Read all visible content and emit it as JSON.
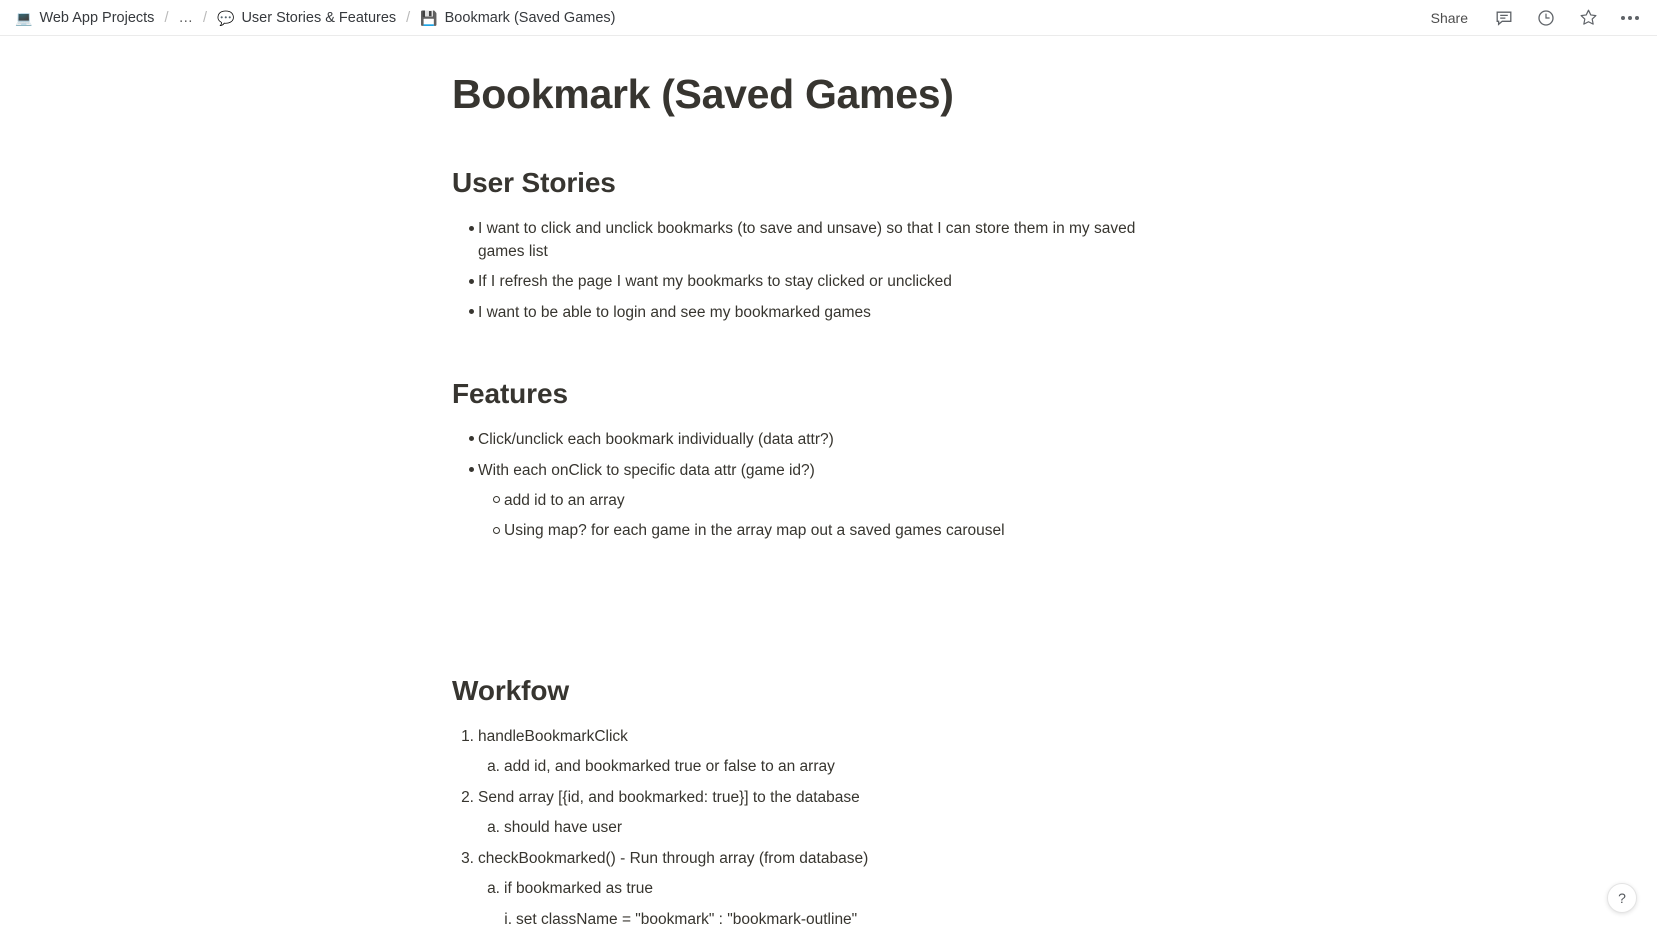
{
  "topbar": {
    "breadcrumb": [
      {
        "icon": "💻",
        "icon_name": "laptop-emoji",
        "label": "Web App Projects"
      },
      {
        "icon": "",
        "icon_name": "",
        "label": "…"
      },
      {
        "icon": "💬",
        "icon_name": "speech-balloon-emoji",
        "label": "User Stories & Features"
      },
      {
        "icon": "💾",
        "icon_name": "floppy-disk-emoji",
        "label": "Bookmark (Saved Games)"
      }
    ],
    "separator": "/",
    "share_label": "Share",
    "icons": [
      "comment-icon",
      "history-clock-icon",
      "star-icon",
      "more-options-icon"
    ]
  },
  "document": {
    "title": "Bookmark (Saved Games)",
    "sections": [
      {
        "heading": "User Stories",
        "items": [
          "I want to click and unclick bookmarks (to save and unsave) so that I can store them in my saved games list",
          "If I refresh the page I want my bookmarks to stay clicked or unclicked",
          "I want to be able to login and see my bookmarked games"
        ]
      },
      {
        "heading": "Features",
        "items": [
          "Click/unclick each bookmark individually (data attr?)",
          "With each onClick to specific data attr (game id?)"
        ],
        "subitems": [
          "add id to an array",
          "Using map? for each game in the array map out a saved games carousel"
        ]
      },
      {
        "heading": "Workfow",
        "steps": [
          {
            "marker": "1.",
            "text": "handleBookmarkClick"
          },
          {
            "marker": "a.",
            "text": "add id, and bookmarked true or false to an array"
          },
          {
            "marker": "2.",
            "text": "Send array [{id, and bookmarked: true}] to the database"
          },
          {
            "marker": "a.",
            "text": "should have user"
          },
          {
            "marker": "3.",
            "text": "checkBookmarked() - Run through array  (from database)"
          },
          {
            "marker": "a.",
            "text": "if bookmarked as true"
          },
          {
            "marker": "i.",
            "text": "set className = \"bookmark\" : \"bookmark-outline\""
          }
        ]
      }
    ]
  },
  "help": {
    "label": "?"
  },
  "colors": {
    "text": "#37352f",
    "heading": "#373530",
    "muted": "#b9b9b9"
  }
}
